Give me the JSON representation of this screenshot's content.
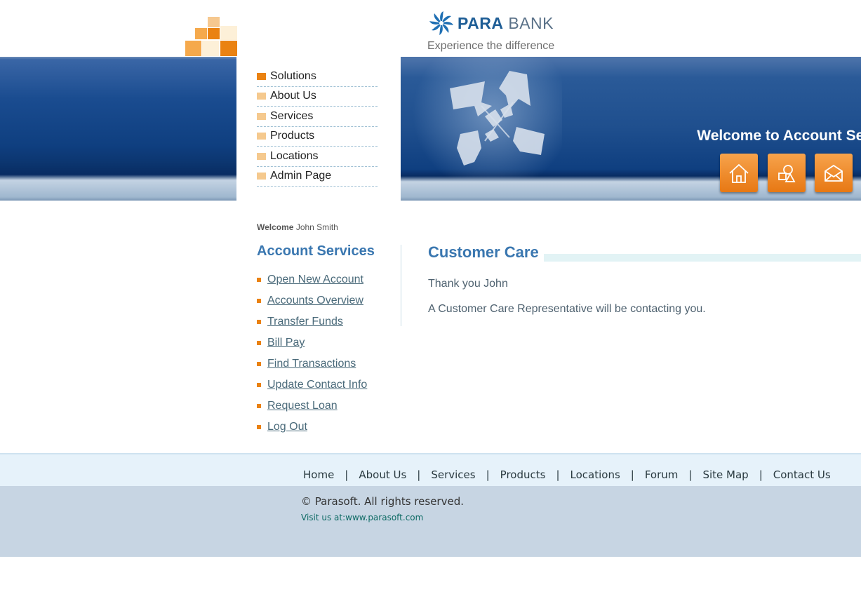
{
  "header": {
    "brand_para": "PARA",
    "brand_bank": "BANK",
    "tagline": "Experience the difference",
    "banner_welcome": "Welcome to Account Servi",
    "icons": [
      "home-icon",
      "about-icon",
      "contact-icon"
    ]
  },
  "solutions_menu": {
    "items": [
      {
        "label": "Solutions"
      },
      {
        "label": "About Us"
      },
      {
        "label": "Services"
      },
      {
        "label": "Products"
      },
      {
        "label": "Locations"
      },
      {
        "label": "Admin Page"
      }
    ]
  },
  "sidebar": {
    "welcome_label": "Welcome",
    "user_name": "John Smith",
    "title": "Account Services",
    "links": [
      {
        "label": "Open New Account"
      },
      {
        "label": "Accounts Overview"
      },
      {
        "label": "Transfer Funds"
      },
      {
        "label": "Bill Pay"
      },
      {
        "label": "Find Transactions"
      },
      {
        "label": "Update Contact Info"
      },
      {
        "label": "Request Loan"
      },
      {
        "label": "Log Out"
      }
    ]
  },
  "main": {
    "title": "Customer Care",
    "thanks": "Thank you John",
    "message": "A Customer Care Representative will be contacting you."
  },
  "footer": {
    "nav": [
      {
        "label": "Home"
      },
      {
        "label": "About Us"
      },
      {
        "label": "Services"
      },
      {
        "label": "Products"
      },
      {
        "label": "Locations"
      },
      {
        "label": "Forum"
      },
      {
        "label": "Site Map"
      },
      {
        "label": "Contact Us"
      }
    ],
    "separator": "|",
    "copyright": "© Parasoft. All rights reserved.",
    "visit": "Visit us at:www.parasoft.com"
  },
  "colors": {
    "accent_orange": "#ea8212",
    "heading_blue": "#3a77b0",
    "banner_blue": "#1a4c90"
  }
}
